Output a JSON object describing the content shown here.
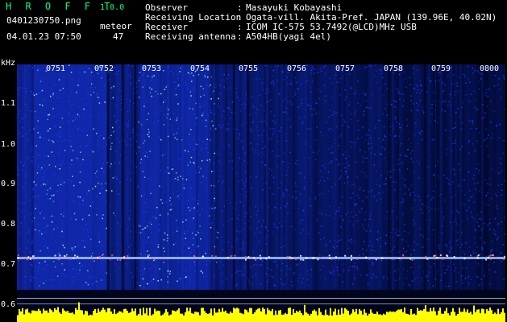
{
  "app": {
    "title": "H R O F F T",
    "version": "1.0.0",
    "filename": "0401230750.png",
    "datetime": "04.01.23 07:50"
  },
  "meteor": {
    "label": "meteor",
    "count": "47"
  },
  "info": [
    {
      "label": "Observer",
      "value": "Masayuki Kobayashi"
    },
    {
      "label": "Receiving Location",
      "value": "Ogata-vill. Akita-Pref. JAPAN (139.96E, 40.02N)"
    },
    {
      "label": "Receiver",
      "value": "ICOM IC-575 53.7492(@LCD)MHz USB"
    },
    {
      "label": "Receiving antenna",
      "value": "A504HB(yagi 4el)"
    }
  ],
  "separator": ":",
  "axis": {
    "y_unit": "kHz",
    "y_ticks": [
      "1.1",
      "1.0",
      "0.9",
      "0.8",
      "0.7",
      "0.6"
    ],
    "x_ticks": [
      "0751",
      "0752",
      "0753",
      "0754",
      "0755",
      "0756",
      "0757",
      "0758",
      "0759",
      "0800"
    ]
  },
  "colors": {
    "background": "#000000",
    "title": "#00ff7f",
    "text": "#ffffff",
    "spectrogram_low": "#00082a",
    "spectrogram_mid": "#1a3cff",
    "spectrogram_high": "#7cffd0",
    "carrier_line": "#a0c8ff",
    "signal_bars": "#ffff00"
  }
}
